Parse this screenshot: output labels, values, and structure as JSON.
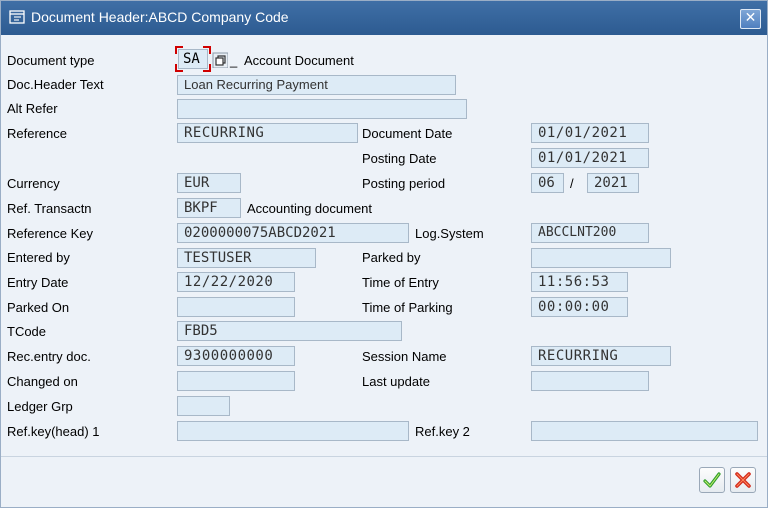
{
  "window": {
    "title": "Document Header:ABCD Company Code",
    "close_icon": "close-x-icon"
  },
  "colors": {
    "title_bar": "#2d5b91",
    "field_bg": "#ddebf6",
    "focus_corner": "#d00000",
    "ok_green": "#2f9d2f",
    "cancel_red": "#d22b1e"
  },
  "form": {
    "document_type": {
      "label": "Document type",
      "value": "SA",
      "description": "Account Document"
    },
    "doc_header_text": {
      "label": "Doc.Header Text",
      "value": "Loan Recurring Payment"
    },
    "alt_refer": {
      "label": "Alt Refer",
      "value": ""
    },
    "reference": {
      "label": "Reference",
      "value": "RECURRING"
    },
    "document_date": {
      "label": "Document Date",
      "value": "01/01/2021"
    },
    "posting_date": {
      "label": "Posting Date",
      "value": "01/01/2021"
    },
    "currency": {
      "label": "Currency",
      "value": "EUR"
    },
    "posting_period": {
      "label": "Posting period",
      "month": "06",
      "separator": "/",
      "year": "2021"
    },
    "ref_transactn": {
      "label": "Ref. Transactn",
      "value": "BKPF",
      "description": "Accounting document"
    },
    "reference_key": {
      "label": "Reference Key",
      "value": "0200000075ABCD2021"
    },
    "log_system": {
      "label": "Log.System",
      "value": "ABCCLNT200"
    },
    "entered_by": {
      "label": "Entered by",
      "value": "TESTUSER"
    },
    "parked_by": {
      "label": "Parked by",
      "value": ""
    },
    "entry_date": {
      "label": "Entry Date",
      "value": "12/22/2020"
    },
    "time_of_entry": {
      "label": "Time of Entry",
      "value": "11:56:53"
    },
    "parked_on": {
      "label": "Parked On",
      "value": ""
    },
    "time_of_parking": {
      "label": "Time of Parking",
      "value": "00:00:00"
    },
    "tcode": {
      "label": "TCode",
      "value": "FBD5"
    },
    "rec_entry_doc": {
      "label": "Rec.entry doc.",
      "value": "9300000000"
    },
    "session_name": {
      "label": "Session Name",
      "value": "RECURRING"
    },
    "changed_on": {
      "label": "Changed on",
      "value": ""
    },
    "last_update": {
      "label": "Last update",
      "value": ""
    },
    "ledger_grp": {
      "label": "Ledger Grp",
      "value": ""
    },
    "ref_key_head1": {
      "label": "Ref.key(head) 1",
      "value": ""
    },
    "ref_key2": {
      "label": "Ref.key 2",
      "value": ""
    }
  },
  "buttons": {
    "ok_icon": "checkmark-icon",
    "cancel_icon": "cancel-x-icon"
  }
}
